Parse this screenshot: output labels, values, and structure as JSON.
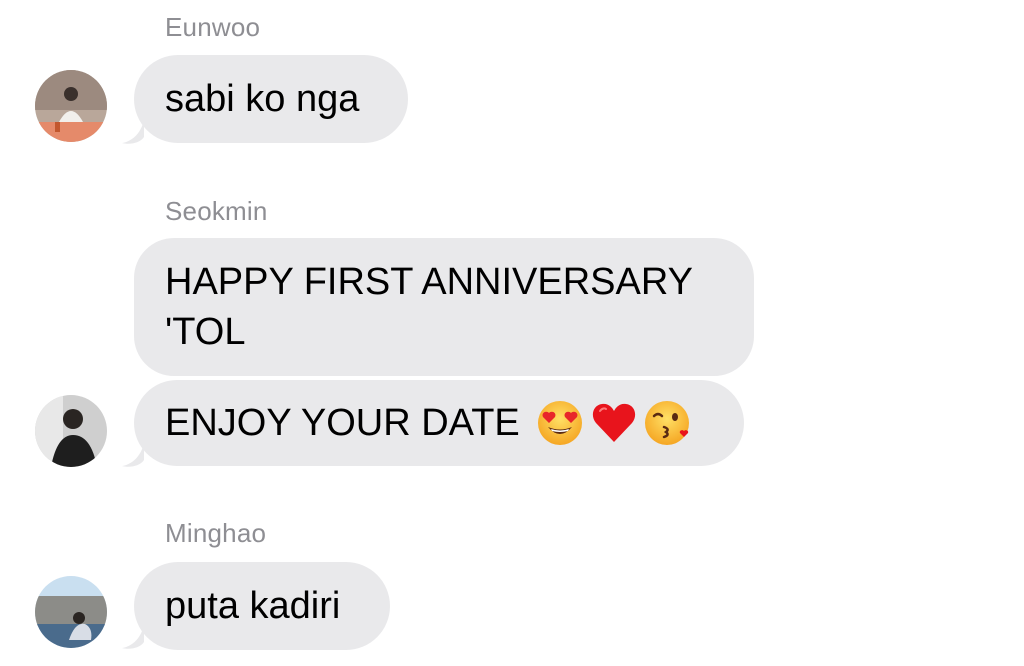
{
  "messages": [
    {
      "sender": "Eunwoo",
      "texts": [
        "sabi ko nga"
      ]
    },
    {
      "sender": "Seokmin",
      "texts": [
        "HAPPY FIRST ANNIVERSARY",
        "'TOL",
        "ENJOY YOUR DATE"
      ],
      "emojis": [
        "heart-eyes-emoji",
        "red-heart-emoji",
        "kissing-heart-emoji"
      ]
    },
    {
      "sender": "Minghao",
      "texts": [
        "puta kadiri"
      ]
    }
  ],
  "colors": {
    "bubble": "#e9e9eb",
    "sender_name": "#8e8e93",
    "text": "#000000"
  }
}
